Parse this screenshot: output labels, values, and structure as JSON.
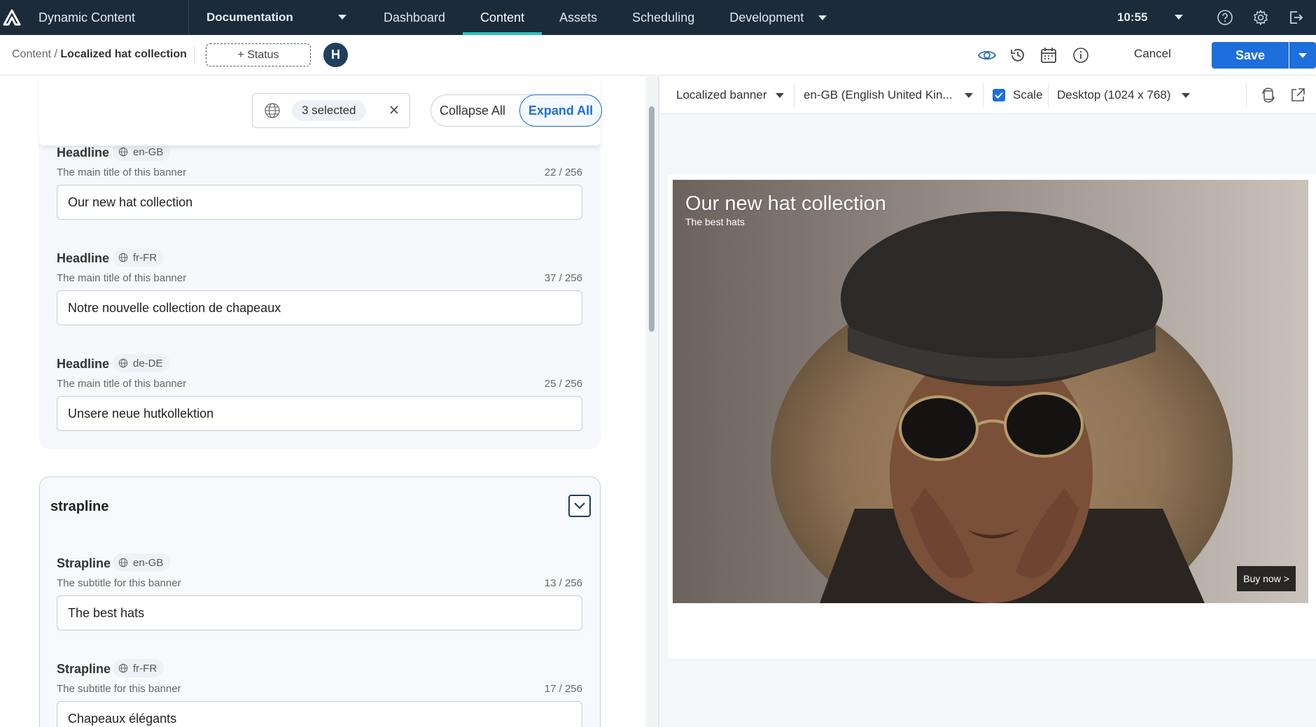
{
  "topnav": {
    "app_name": "Dynamic Content",
    "hub_selector": "Documentation",
    "tabs": [
      {
        "label": "Dashboard",
        "active": false
      },
      {
        "label": "Content",
        "active": true
      },
      {
        "label": "Assets",
        "active": false
      },
      {
        "label": "Scheduling",
        "active": false
      },
      {
        "label": "Development",
        "active": false
      }
    ],
    "time": "10:55",
    "accent_color": "#2ec0b8",
    "icons": [
      "help-icon",
      "gear-icon",
      "logout-icon"
    ]
  },
  "toolbar": {
    "breadcrumb_root": "Content",
    "breadcrumb_sep": "/",
    "breadcrumb_current": "Localized hat collection",
    "status_label": "+ Status",
    "avatar_initial": "H",
    "cancel_label": "Cancel",
    "save_label": "Save",
    "save_color": "#1c6fdc",
    "icons": [
      "eye-icon",
      "history-icon",
      "calendar-icon",
      "info-icon"
    ]
  },
  "editor": {
    "locale_filter_label": "3 selected",
    "collapse_all": "Collapse All",
    "expand_all": "Expand All",
    "headline_fields": [
      {
        "label": "Headline",
        "locale": "en-GB",
        "description": "The main title of this banner",
        "count": "22 / 256",
        "value": "Our new hat collection"
      },
      {
        "label": "Headline",
        "locale": "fr-FR",
        "description": "The main title of this banner",
        "count": "37 / 256",
        "value": "Notre nouvelle collection de chapeaux"
      },
      {
        "label": "Headline",
        "locale": "de-DE",
        "description": "The main title of this banner",
        "count": "25 / 256",
        "value": "Unsere neue hutkollektion"
      }
    ],
    "strapline_section": "strapline",
    "strapline_fields": [
      {
        "label": "Strapline",
        "locale": "en-GB",
        "description": "The subtitle for this banner",
        "count": "13 / 256",
        "value": "The best hats"
      },
      {
        "label": "Strapline",
        "locale": "fr-FR",
        "description": "The subtitle for this banner",
        "count": "17 / 256",
        "value": "Chapeaux élégants"
      }
    ]
  },
  "preview": {
    "visualization": "Localized banner",
    "locale": "en-GB (English United Kin...",
    "scale_label": "Scale",
    "scale_checked": true,
    "device": "Desktop (1024 x 768)",
    "banner_title": "Our new hat collection",
    "banner_subtitle": "The best hats",
    "banner_button": "Buy now >",
    "icons": [
      "sync-icon",
      "external-link-icon"
    ]
  }
}
